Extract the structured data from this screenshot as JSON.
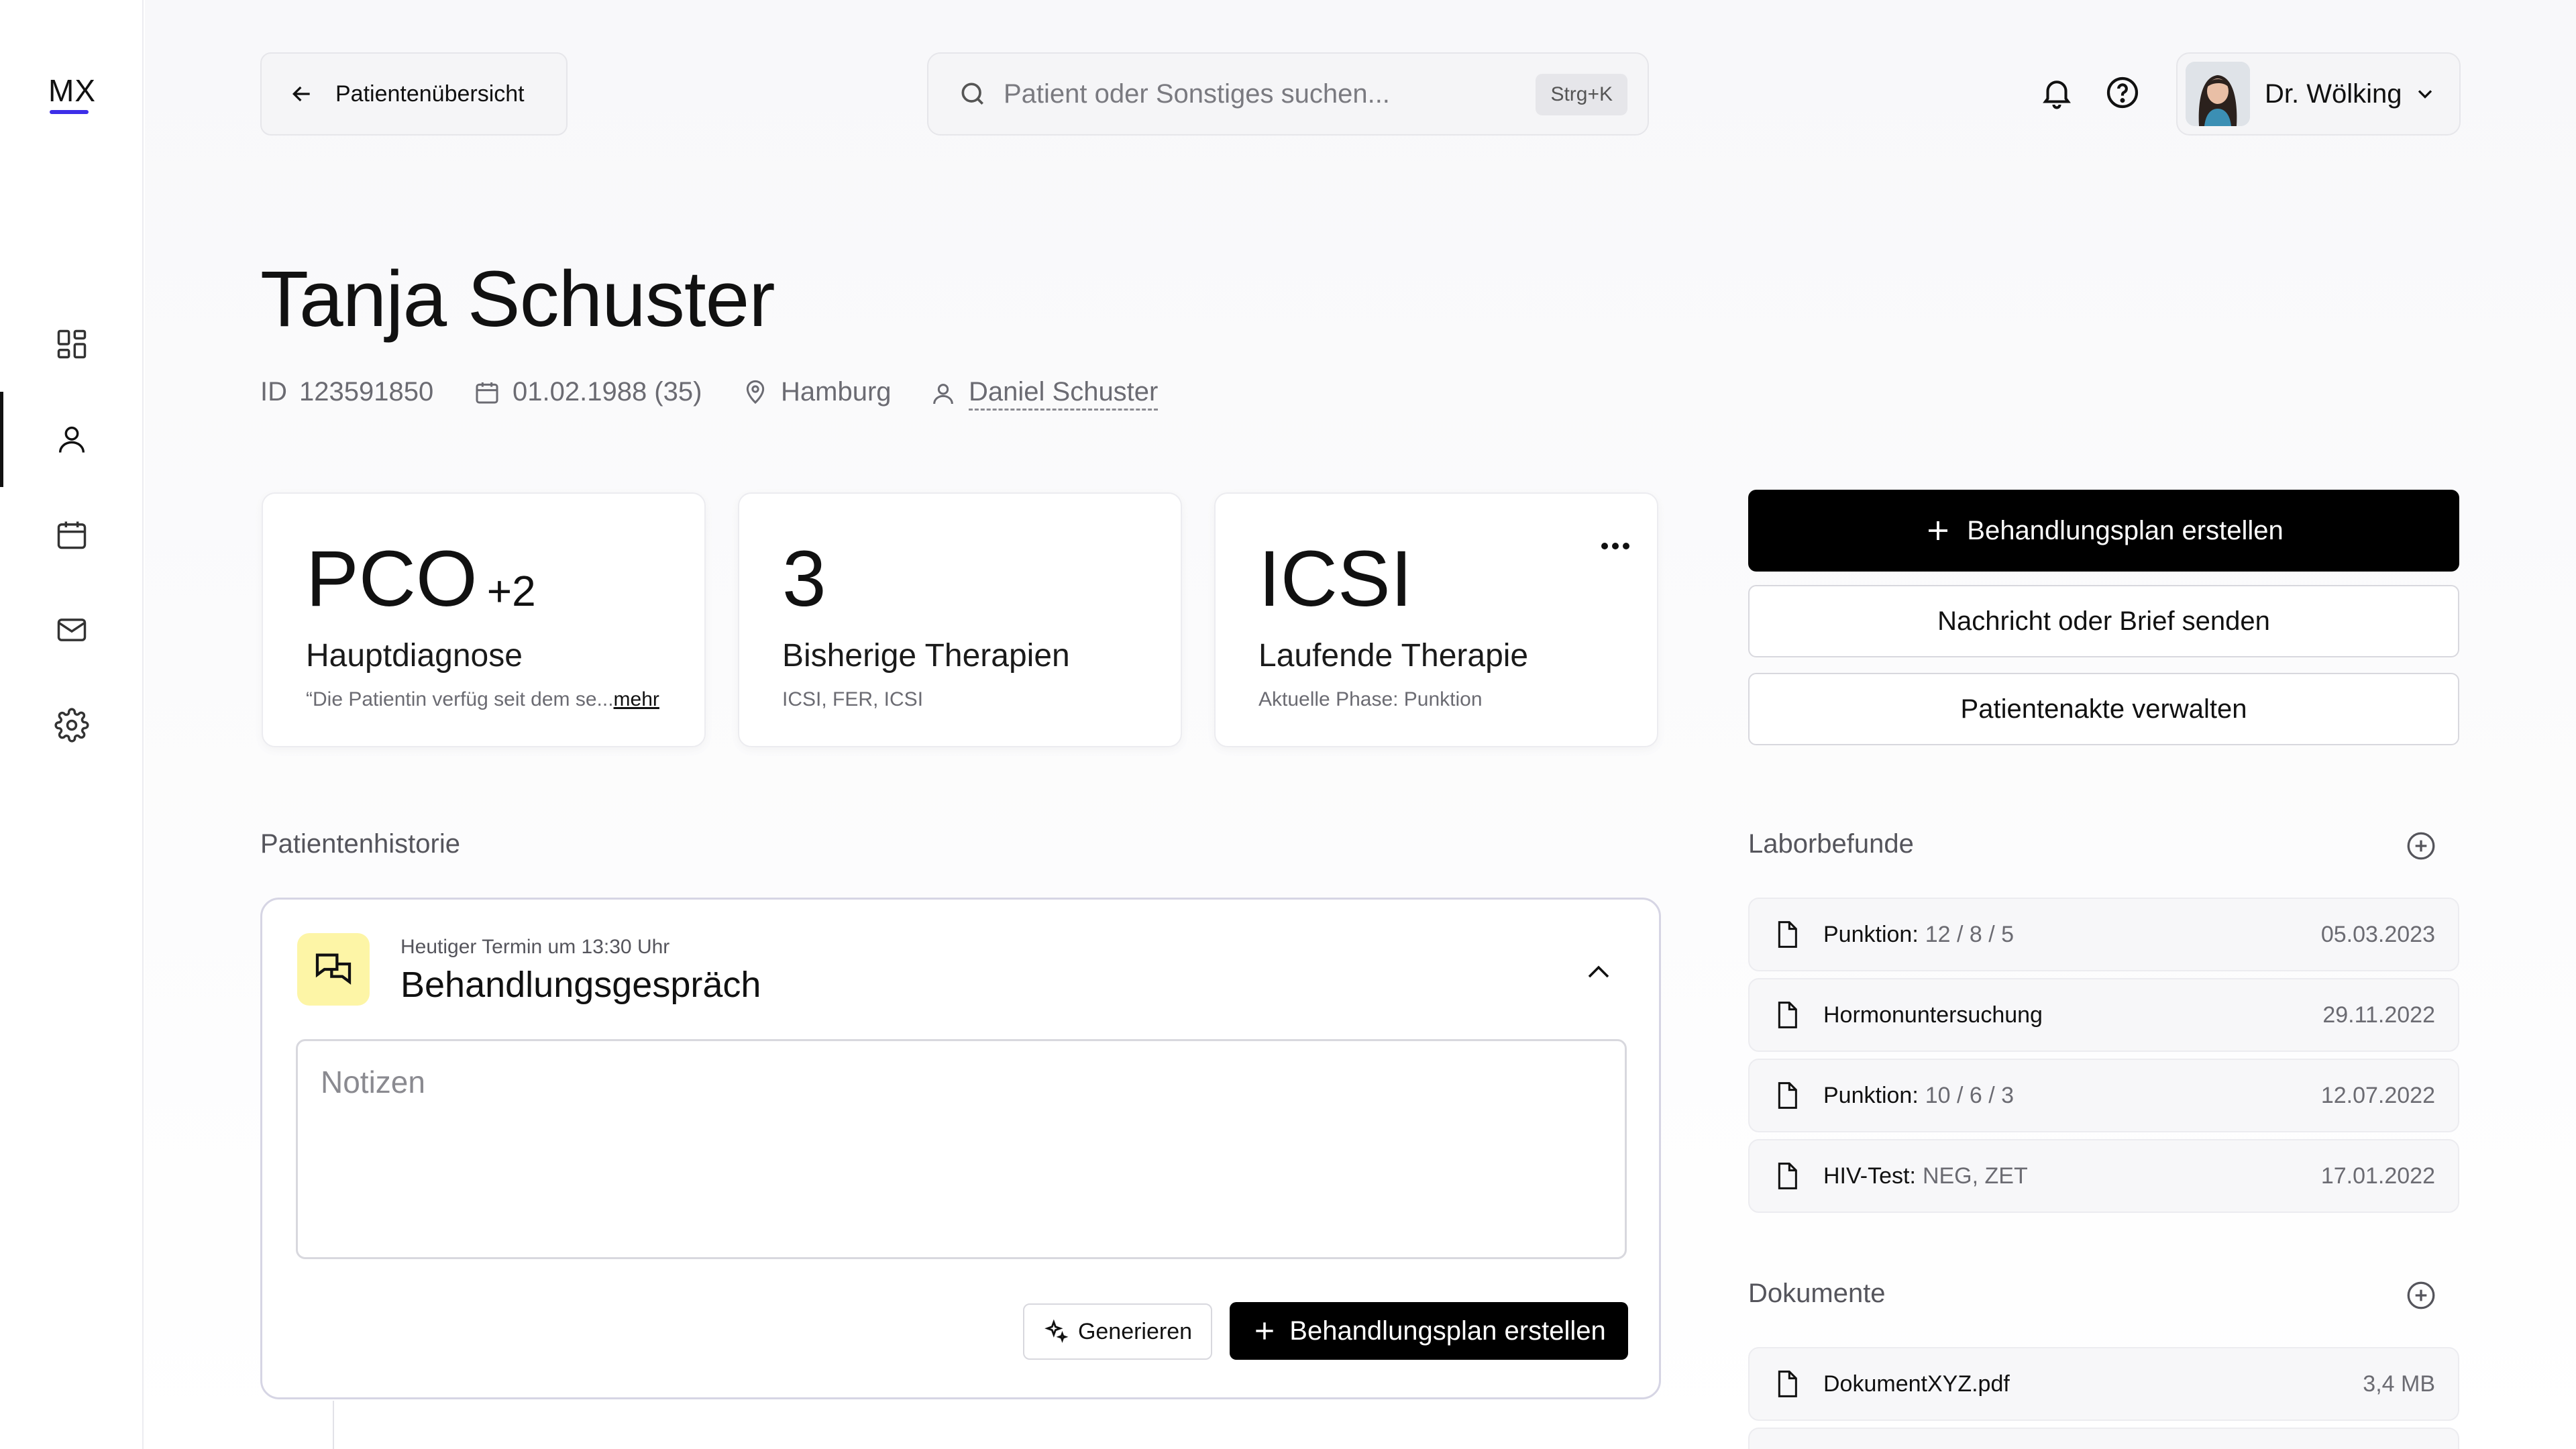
{
  "app": {
    "logo": "MX"
  },
  "header": {
    "back_label": "Patientenübersicht",
    "search_placeholder": "Patient oder Sonstiges suchen...",
    "search_shortcut": "Strg+K",
    "user_name": "Dr. Wölking"
  },
  "sidebar": {
    "items": [
      {
        "icon": "dashboard-icon"
      },
      {
        "icon": "user-icon",
        "active": true
      },
      {
        "icon": "calendar-icon"
      },
      {
        "icon": "mail-icon"
      },
      {
        "icon": "gear-icon"
      }
    ]
  },
  "patient": {
    "name": "Tanja Schuster",
    "id_label": "ID",
    "id_value": "123591850",
    "birthdate": "01.02.1988 (35)",
    "city": "Hamburg",
    "partner": "Daniel Schuster"
  },
  "cards": [
    {
      "big": "PCO",
      "extra": "+2",
      "label": "Hauptdiagnose",
      "sub": "“Die Patientin verfüg seit dem se...",
      "sub_link": "mehr"
    },
    {
      "big": "3",
      "label": "Bisherige Therapien",
      "sub": "ICSI, FER, ICSI"
    },
    {
      "big": "ICSI",
      "label": "Laufende Therapie",
      "sub": "Aktuelle Phase: Punktion"
    }
  ],
  "actions": {
    "primary": "Behandlungsplan erstellen",
    "message": "Nachricht oder Brief senden",
    "manage": "Patientenakte verwalten"
  },
  "history": {
    "section_title": "Patientenhistorie",
    "kicker": "Heutiger Termin um 13:30 Uhr",
    "title": "Behandlungsgespräch",
    "notes_placeholder": "Notizen",
    "generate_label": "Generieren",
    "plan_label": "Behandlungsplan erstellen"
  },
  "lab": {
    "section_title": "Laborbefunde",
    "rows": [
      {
        "name": "Punktion:",
        "detail": "12 / 8 / 5",
        "date": "05.03.2023"
      },
      {
        "name": "Hormonuntersuchung",
        "detail": "",
        "date": "29.11.2022"
      },
      {
        "name": "Punktion:",
        "detail": "10 / 6 / 3",
        "date": "12.07.2022"
      },
      {
        "name": "HIV-Test:",
        "detail": "NEG, ZET",
        "date": "17.01.2022"
      }
    ]
  },
  "documents": {
    "section_title": "Dokumente",
    "rows": [
      {
        "name": "DokumentXYZ.pdf",
        "size": "3,4 MB"
      }
    ]
  },
  "colors": {
    "accent": "#3d2ee8",
    "primary_button": "#000000",
    "history_icon_bg": "#fdf5a6",
    "history_border": "#d6d5e4"
  }
}
